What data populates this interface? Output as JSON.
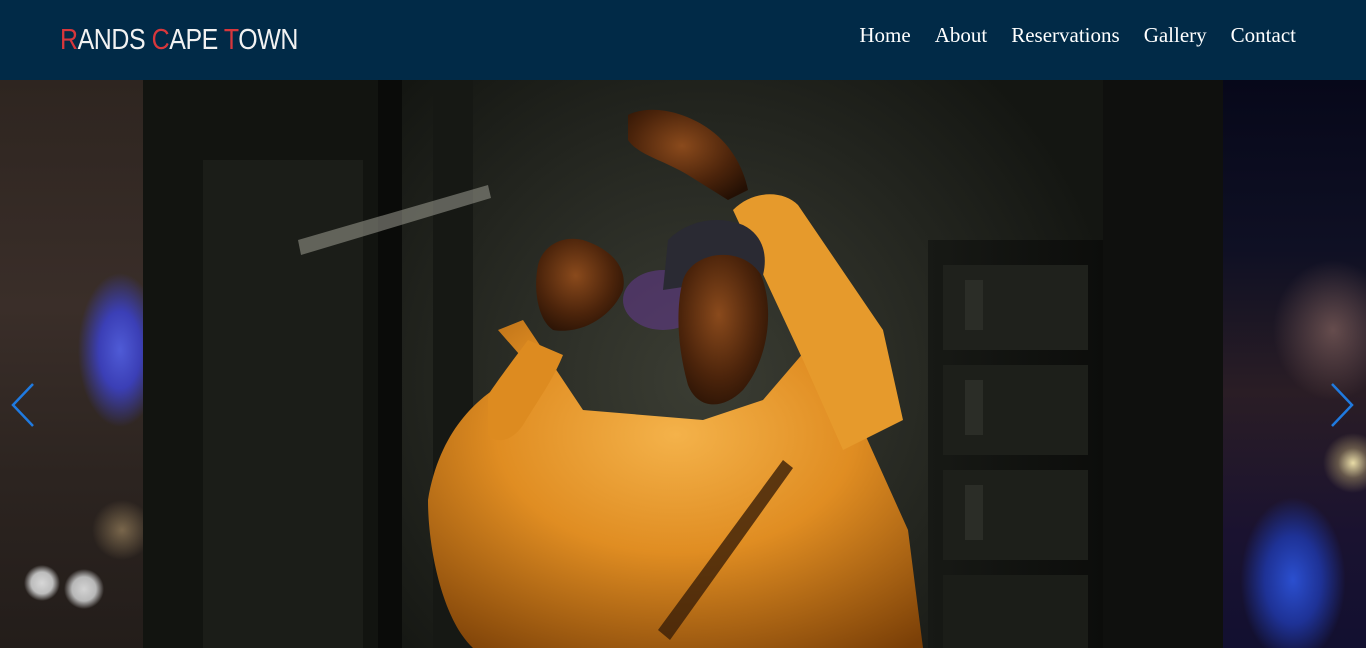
{
  "brand": {
    "letters": [
      {
        "cap": "R",
        "rest": "ANDS "
      },
      {
        "cap": "C",
        "rest": "APE "
      },
      {
        "cap": "T",
        "rest": "OWN"
      }
    ]
  },
  "nav": {
    "items": [
      "Home",
      "About",
      "Reservations",
      "Gallery",
      "Contact"
    ]
  },
  "carousel": {
    "prev_icon": "chevron-left-icon",
    "next_icon": "chevron-right-icon"
  },
  "colors": {
    "navbar_bg": "#012a47",
    "logo_accent": "#d7373c",
    "arrow": "#1f7ae0"
  }
}
